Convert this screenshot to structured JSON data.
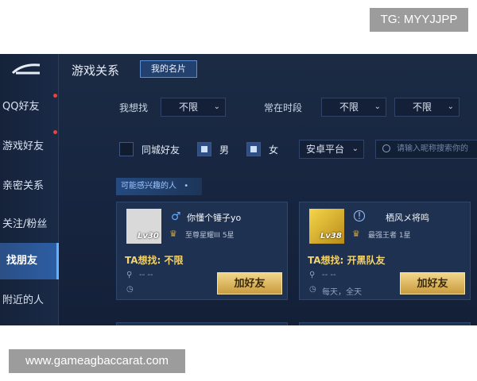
{
  "watermarks": {
    "top": "TG: MYYJJPP",
    "bottom": "www.gameagbaccarat.com"
  },
  "sidebar": {
    "items": [
      {
        "label": "QQ好友",
        "dot": true
      },
      {
        "label": "游戏好友",
        "dot": true
      },
      {
        "label": "亲密关系",
        "dot": false
      },
      {
        "label": "关注/粉丝",
        "dot": false
      },
      {
        "label": "找朋友",
        "active": true
      },
      {
        "label": "附近的人",
        "dot": false
      }
    ]
  },
  "header": {
    "title": "游戏关系",
    "tab": "我的名片"
  },
  "filters": {
    "want_label": "我想找",
    "want_value": "不限",
    "time_label": "常在时段",
    "time_value_1": "不限",
    "time_value_2": "不限",
    "same_city": "同城好友",
    "male": "男",
    "female": "女",
    "platform": "安卓平台",
    "search_placeholder": "请输入昵称搜索你的"
  },
  "section_tag": "可能感兴趣的人",
  "cards": [
    {
      "name": "你懂个锤子yo",
      "level": "Lv30",
      "rank": "至尊星耀III 5星",
      "ta": "TA想找: 不限",
      "location": "-- --",
      "time": "",
      "button": "加好友"
    },
    {
      "name": "栖风メ将鸣",
      "level": "Lv38",
      "rank": "最强王者 1星",
      "ta": "TA想找: 开黑队友",
      "location": "-- --",
      "time": "每天，全天",
      "button": "加好友"
    }
  ],
  "colors": {
    "accent": "#5fb3ff",
    "gold": "#f4d36d",
    "panel": "#1f3150",
    "bg": "#172540"
  }
}
